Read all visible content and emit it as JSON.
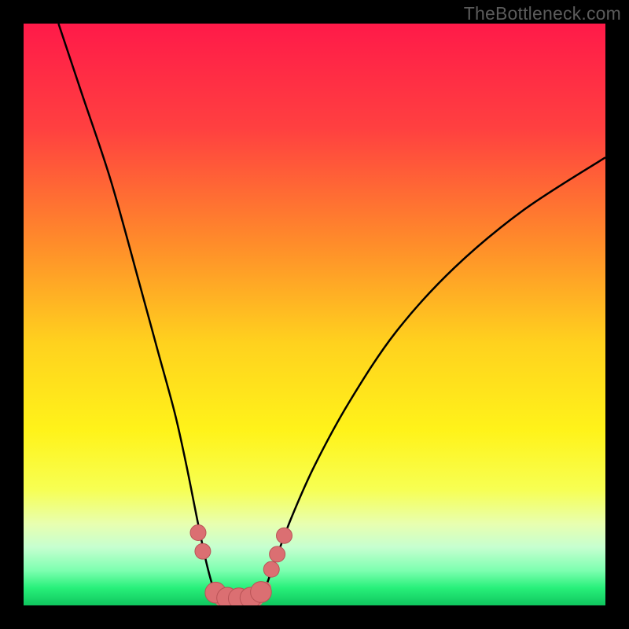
{
  "watermark": "TheBottleneck.com",
  "colors": {
    "frame": "#000000",
    "gradient_stops": [
      {
        "offset": 0.0,
        "color": "#ff1a49"
      },
      {
        "offset": 0.18,
        "color": "#ff4040"
      },
      {
        "offset": 0.38,
        "color": "#ff8d2a"
      },
      {
        "offset": 0.55,
        "color": "#ffd21e"
      },
      {
        "offset": 0.7,
        "color": "#fff31a"
      },
      {
        "offset": 0.8,
        "color": "#f7ff52"
      },
      {
        "offset": 0.86,
        "color": "#e8ffb0"
      },
      {
        "offset": 0.9,
        "color": "#c6ffd0"
      },
      {
        "offset": 0.94,
        "color": "#7dffb0"
      },
      {
        "offset": 0.97,
        "color": "#28f07a"
      },
      {
        "offset": 1.0,
        "color": "#0fc65e"
      }
    ],
    "curve": "#000000",
    "marker_fill": "#db6f72",
    "marker_stroke": "#b95356"
  },
  "chart_data": {
    "type": "line",
    "title": "",
    "xlabel": "",
    "ylabel": "",
    "xlim": [
      0,
      100
    ],
    "ylim": [
      0,
      100
    ],
    "series": [
      {
        "name": "bottleneck-curve-left",
        "x": [
          6,
          10,
          15,
          20,
          23,
          26,
          28,
          30,
          31.5,
          32.8,
          34
        ],
        "y": [
          100,
          88,
          73,
          55,
          44,
          33,
          24,
          14,
          7,
          2.5,
          1
        ]
      },
      {
        "name": "bottleneck-curve-right",
        "x": [
          40,
          41.5,
          43,
          46,
          50,
          56,
          64,
          74,
          86,
          100
        ],
        "y": [
          1,
          3,
          7,
          15,
          24,
          35,
          47,
          58,
          68,
          77
        ]
      },
      {
        "name": "valley-floor",
        "x": [
          34,
          36,
          38,
          40
        ],
        "y": [
          1,
          0.8,
          0.8,
          1
        ]
      }
    ],
    "markers": [
      {
        "x": 30.0,
        "y": 12.5,
        "r": 1.5
      },
      {
        "x": 30.8,
        "y": 9.3,
        "r": 1.5
      },
      {
        "x": 33.0,
        "y": 2.2,
        "r": 2.0
      },
      {
        "x": 35.0,
        "y": 1.3,
        "r": 2.0
      },
      {
        "x": 37.0,
        "y": 1.2,
        "r": 2.0
      },
      {
        "x": 39.0,
        "y": 1.3,
        "r": 2.0
      },
      {
        "x": 40.8,
        "y": 2.3,
        "r": 2.0
      },
      {
        "x": 42.6,
        "y": 6.2,
        "r": 1.5
      },
      {
        "x": 43.6,
        "y": 8.8,
        "r": 1.5
      },
      {
        "x": 44.8,
        "y": 12.0,
        "r": 1.5
      }
    ]
  }
}
